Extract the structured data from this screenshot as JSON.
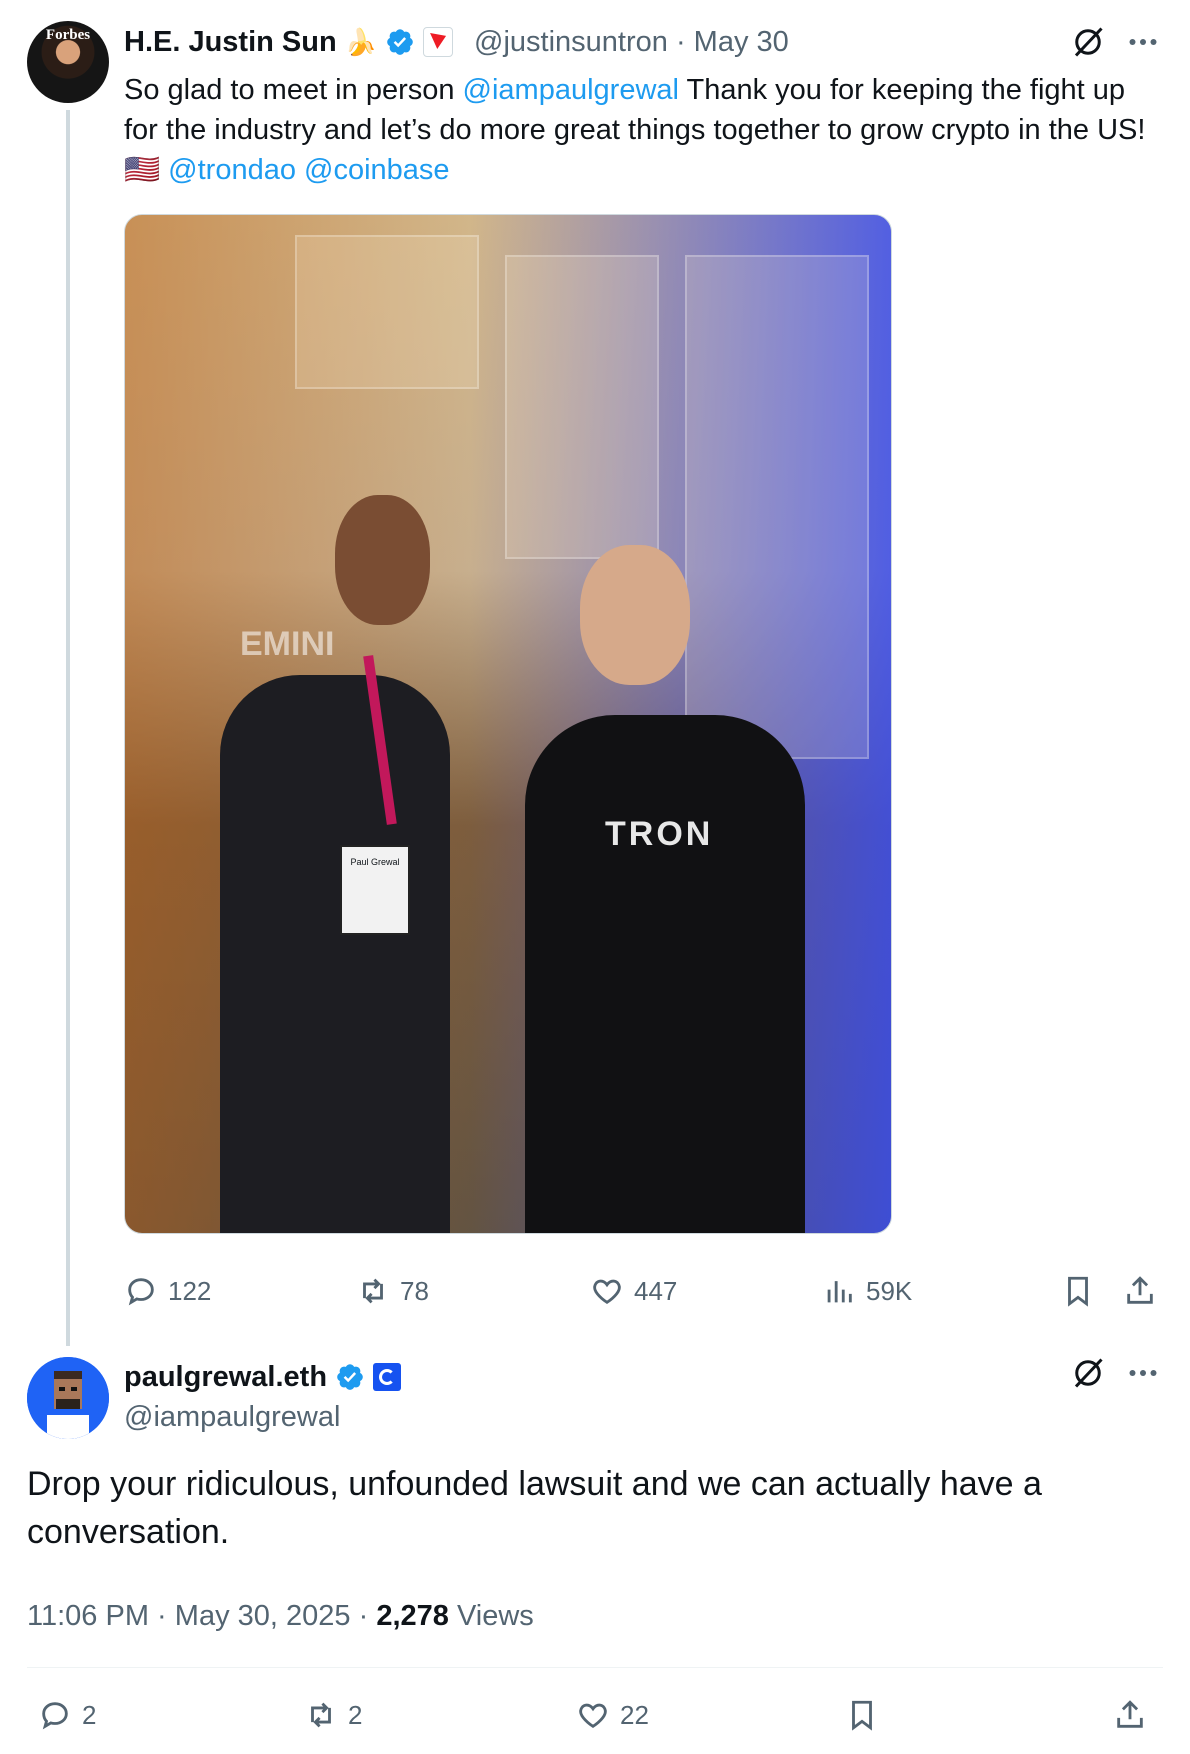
{
  "tweet1": {
    "avatar_text": "Forbes",
    "display_name": "H.E. Justin Sun",
    "name_emoji": "🍌",
    "handle": "@justinsuntron",
    "date": "May 30",
    "text_segments": [
      {
        "text": "So glad to meet in person ",
        "link": false
      },
      {
        "text": "@iampaulgrewal",
        "link": true
      },
      {
        "text": " Thank you for keeping the fight up for the industry and let’s do more great things together to grow crypto in the US! ",
        "link": false
      },
      {
        "text": "🇺🇸 ",
        "link": false
      },
      {
        "text": "@trondao",
        "link": true
      },
      {
        "text": " ",
        "link": false
      },
      {
        "text": "@coinbase",
        "link": true
      }
    ],
    "photo": {
      "background_sign": "EMINI",
      "badge_text": "Paul Grewal",
      "shirt_logo": "TRON"
    },
    "actions": {
      "replies": "122",
      "retweets": "78",
      "likes": "447",
      "views": "59K"
    }
  },
  "tweet2": {
    "display_name": "paulgrewal.eth",
    "handle": "@iampaulgrewal",
    "text": "Drop your ridiculous, unfounded lawsuit and we can actually have a conversation.",
    "time": "11:06 PM",
    "date": "May 30, 2025",
    "views_count": "2,278",
    "views_label": "Views",
    "separator": "·",
    "actions": {
      "replies": "2",
      "retweets": "2",
      "likes": "22"
    }
  },
  "colors": {
    "link": "#1d9bf0",
    "verified": "#1d9bf0",
    "muted": "#536471",
    "text": "#0f1419"
  }
}
